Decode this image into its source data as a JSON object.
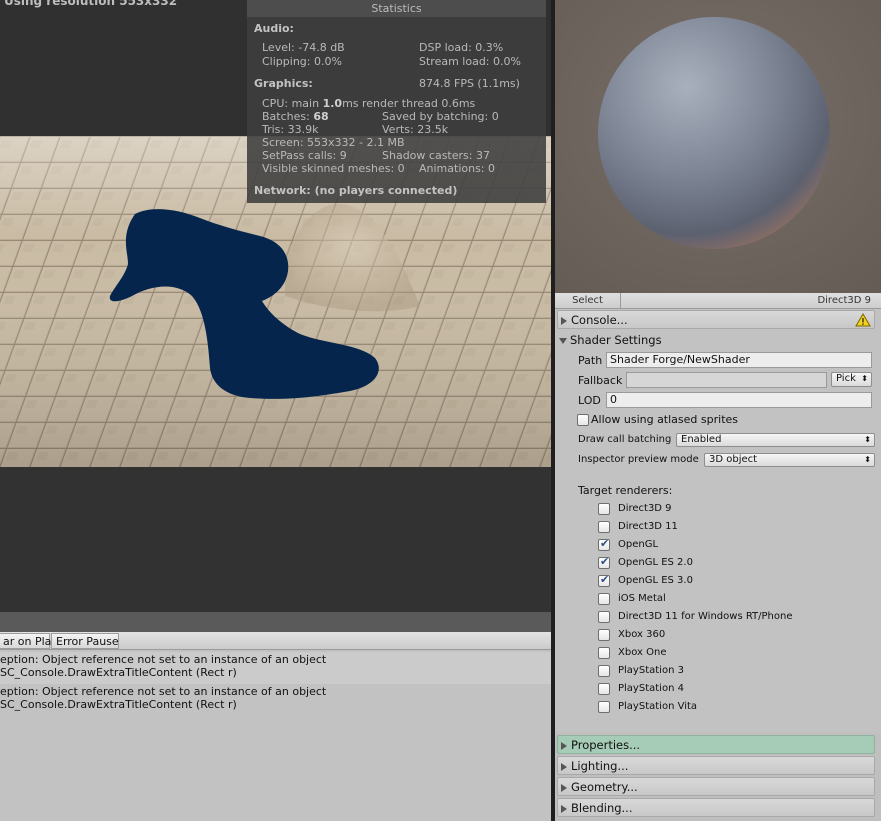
{
  "game_view": {
    "resolution_text": "Using resolution 553x332"
  },
  "statistics": {
    "title": "Statistics",
    "audio_header": "Audio:",
    "level": "Level: -74.8 dB",
    "dsp_load": "DSP load: 0.3%",
    "clipping": "Clipping: 0.0%",
    "stream_load": "Stream load: 0.0%",
    "graphics_header": "Graphics:",
    "fps": "874.8 FPS (1.1ms)",
    "cpu_prefix": "CPU: main ",
    "cpu_main": "1.0",
    "cpu_suffix": "ms  render thread 0.6ms",
    "batches_prefix": "Batches: ",
    "batches_value": "68",
    "saved_by_batching": "Saved by batching: 0",
    "tris": "Tris: 33.9k",
    "verts": "Verts: 23.5k",
    "screen": "Screen: 553x332 - 2.1 MB",
    "setpass": "SetPass calls: 9",
    "shadow_casters": "Shadow casters: 37",
    "visible_skinned": "Visible skinned meshes: 0",
    "animations": "Animations: 0",
    "network": "Network: (no players connected)"
  },
  "console": {
    "toolbar": {
      "clear_on_play": "ar on Play",
      "error_pause": "Error Pause"
    },
    "entries": [
      {
        "line1": "eption: Object reference not set to an instance of an object",
        "line2": "SC_Console.DrawExtraTitleContent (Rect r)"
      },
      {
        "line1": "eption: Object reference not set to an instance of an object",
        "line2": "SC_Console.DrawExtraTitleContent (Rect r)"
      }
    ]
  },
  "preview": {
    "select_label": "Select",
    "api_label": "Direct3D 9"
  },
  "sections": {
    "console": "Console...",
    "shader_settings": "Shader Settings",
    "properties": "Properties...",
    "lighting": "Lighting...",
    "geometry": "Geometry...",
    "blending": "Blending..."
  },
  "shader_settings": {
    "path_label": "Path",
    "path_value": "Shader Forge/NewShader",
    "fallback_label": "Fallback",
    "fallback_value": "",
    "pick_label": "Pick",
    "lod_label": "LOD",
    "lod_value": "0",
    "atlased_label": "Allow using atlased sprites",
    "atlased_checked": false,
    "draw_call_label": "Draw call batching",
    "draw_call_value": "Enabled",
    "inspector_preview_label": "Inspector preview mode",
    "inspector_preview_value": "3D object",
    "target_renderers_label": "Target renderers:",
    "renderers": [
      {
        "name": "Direct3D 9",
        "checked": false
      },
      {
        "name": "Direct3D 11",
        "checked": false
      },
      {
        "name": "OpenGL",
        "checked": true
      },
      {
        "name": "OpenGL ES 2.0",
        "checked": true
      },
      {
        "name": "OpenGL ES 3.0",
        "checked": true
      },
      {
        "name": "iOS Metal",
        "checked": false
      },
      {
        "name": "Direct3D 11 for Windows RT/Phone",
        "checked": false
      },
      {
        "name": "Xbox 360",
        "checked": false
      },
      {
        "name": "Xbox One",
        "checked": false
      },
      {
        "name": "PlayStation 3",
        "checked": false
      },
      {
        "name": "PlayStation 4",
        "checked": false
      },
      {
        "name": "PlayStation Vita",
        "checked": false
      }
    ]
  },
  "icons": {
    "warning": "warning-icon",
    "foldout": "triangle-icon"
  },
  "colors": {
    "properties_highlight": "#a6cbb6",
    "blob": "#06254d",
    "panel_bg": "#c2c2c2"
  }
}
